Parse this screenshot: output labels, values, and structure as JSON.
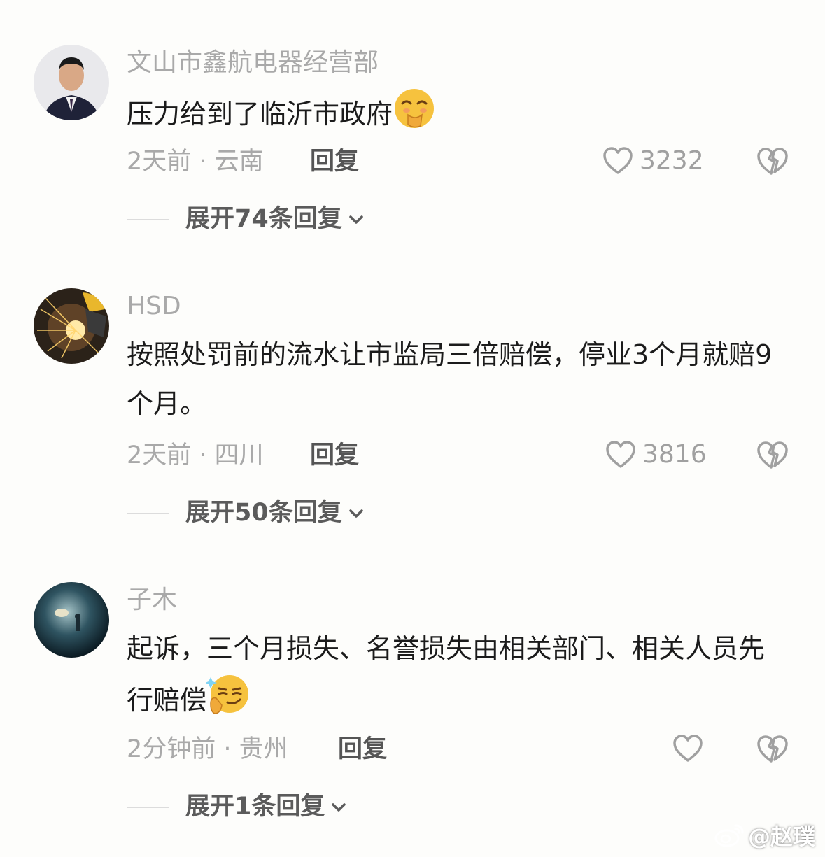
{
  "comments": [
    {
      "username": "文山市鑫航电器经营部",
      "text": "压力给到了临沂市政府",
      "emoji": "smirk-hand-emoji",
      "time_location": "2天前 · 云南",
      "reply_label": "回复",
      "likes": "3232",
      "expand_label": "展开74条回复"
    },
    {
      "username": "HSD",
      "text": "按照处罚前的流水让市监局三倍赔偿，停业3个月就赔9个月。",
      "time_location": "2天前 · 四川",
      "reply_label": "回复",
      "likes": "3816",
      "expand_label": "展开50条回复"
    },
    {
      "username": "子木",
      "text": "起诉，三个月损失、名誉损失由相关部门、相关人员先行赔偿",
      "emoji": "thinking-smirk-emoji",
      "time_location": "2分钟前 · 贵州",
      "reply_label": "回复",
      "likes": "",
      "expand_label": "展开1条回复"
    }
  ],
  "watermark": "@赵璞",
  "colors": {
    "background": "#fdfdfb",
    "muted": "#a9a9a9",
    "text": "#1b1b1b",
    "emoji": "#f6c23e"
  }
}
